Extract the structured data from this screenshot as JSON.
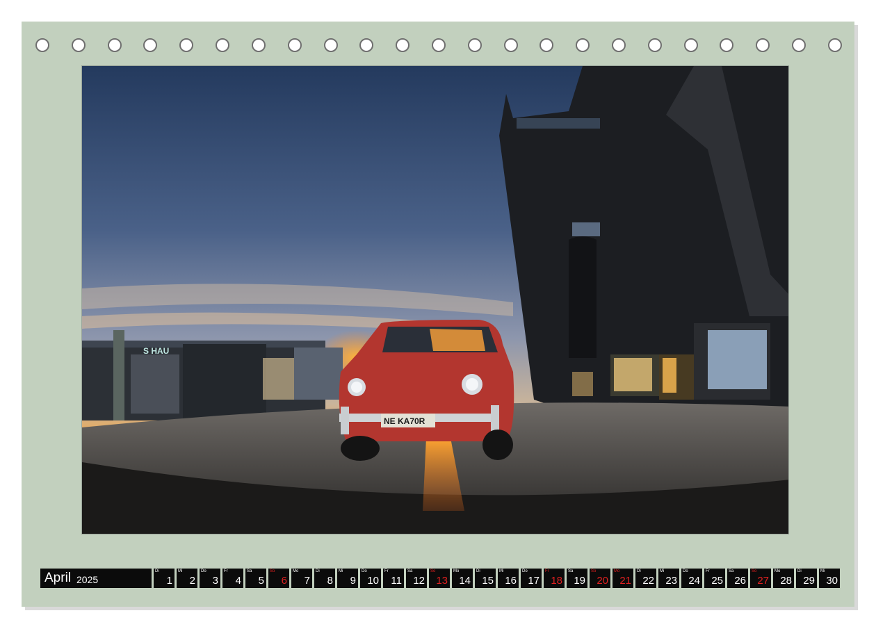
{
  "calendar": {
    "month": "April",
    "year": "2025",
    "days": [
      {
        "wd": "Di",
        "d": "1",
        "red": false
      },
      {
        "wd": "Mi",
        "d": "2",
        "red": false
      },
      {
        "wd": "Do",
        "d": "3",
        "red": false
      },
      {
        "wd": "Fr",
        "d": "4",
        "red": false
      },
      {
        "wd": "Sa",
        "d": "5",
        "red": false
      },
      {
        "wd": "So",
        "d": "6",
        "red": true
      },
      {
        "wd": "Mo",
        "d": "7",
        "red": false
      },
      {
        "wd": "Di",
        "d": "8",
        "red": false
      },
      {
        "wd": "Mi",
        "d": "9",
        "red": false
      },
      {
        "wd": "Do",
        "d": "10",
        "red": false
      },
      {
        "wd": "Fr",
        "d": "11",
        "red": false
      },
      {
        "wd": "Sa",
        "d": "12",
        "red": false
      },
      {
        "wd": "So",
        "d": "13",
        "red": true
      },
      {
        "wd": "Mo",
        "d": "14",
        "red": false
      },
      {
        "wd": "Di",
        "d": "15",
        "red": false
      },
      {
        "wd": "Mi",
        "d": "16",
        "red": false
      },
      {
        "wd": "Do",
        "d": "17",
        "red": false
      },
      {
        "wd": "Fr",
        "d": "18",
        "red": true
      },
      {
        "wd": "Sa",
        "d": "19",
        "red": false
      },
      {
        "wd": "So",
        "d": "20",
        "red": true
      },
      {
        "wd": "Mo",
        "d": "21",
        "red": true
      },
      {
        "wd": "Di",
        "d": "22",
        "red": false
      },
      {
        "wd": "Mi",
        "d": "23",
        "red": false
      },
      {
        "wd": "Do",
        "d": "24",
        "red": false
      },
      {
        "wd": "Fr",
        "d": "25",
        "red": false
      },
      {
        "wd": "Sa",
        "d": "26",
        "red": false
      },
      {
        "wd": "So",
        "d": "27",
        "red": true
      },
      {
        "wd": "Mo",
        "d": "28",
        "red": false
      },
      {
        "wd": "Di",
        "d": "29",
        "red": false
      },
      {
        "wd": "Mi",
        "d": "30",
        "red": false
      }
    ]
  },
  "photo": {
    "sign_text": "S HAU",
    "plate_text": "NE KA70R"
  },
  "colors": {
    "page_background": "#c2d0be",
    "calendar_cell": "#0b0b0b",
    "holiday_red": "#e02020"
  }
}
